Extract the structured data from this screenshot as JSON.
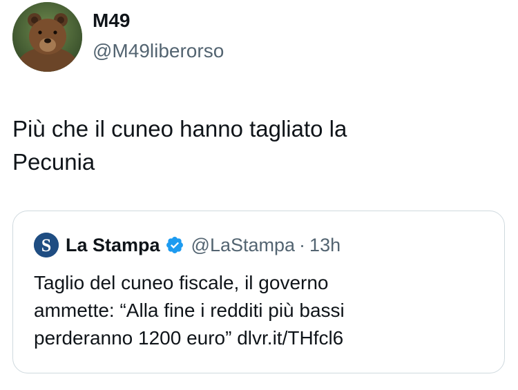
{
  "tweet": {
    "author_name": "M49",
    "author_handle": "@M49liberorso",
    "avatar_icon": "bear-avatar",
    "text_line1": "Più che il cuneo hanno tagliato la",
    "text_line2": "Pecunia"
  },
  "quoted_tweet": {
    "logo_icon": "la-stampa-logo",
    "logo_letter": "S",
    "author_name": "La Stampa",
    "verified_icon": "verified-badge-icon",
    "author_handle": "@LaStampa",
    "separator": "·",
    "time": "13h",
    "text_line1": "Taglio del cuneo fiscale, il governo",
    "text_line2": "ammette: “Alla fine i redditi più bassi",
    "text_line3": "perderanno 1200 euro” dlvr.it/THfcl6"
  },
  "colors": {
    "text_primary": "#0f1419",
    "text_secondary": "#536471",
    "border": "#cfd9de",
    "verified": "#1d9bf0",
    "stampa_logo": "#1f4d82"
  }
}
